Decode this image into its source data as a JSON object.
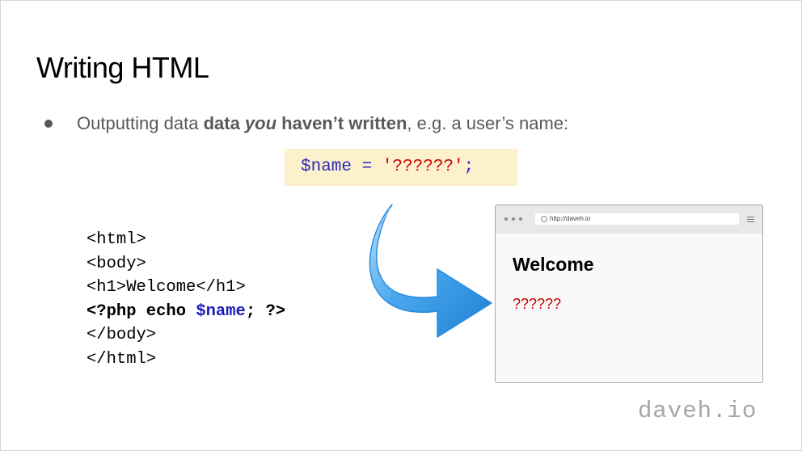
{
  "slide": {
    "title": "Writing HTML",
    "bullet": {
      "text_before": "Outputting data ",
      "bold_1": "data ",
      "bold_italic": "you",
      "bold_2": " haven’t written",
      "text_after": ", e.g. a user’s name:"
    },
    "php_assignment": {
      "variable": "$name",
      "operator": " = ",
      "string": "'??????'",
      "terminator": ";"
    },
    "code_lines": {
      "l1": "<html>",
      "l2": "<body>",
      "l3": "<h1>Welcome</h1>",
      "l4_start": "<?php echo ",
      "l4_var": "$name",
      "l4_end": "; ?>",
      "l5": "</body>",
      "l6": "</html>"
    },
    "browser": {
      "url": "http://daveh.io",
      "heading": "Welcome",
      "output": "??????"
    },
    "watermark": "daveh.io"
  },
  "colors": {
    "code_box_bg": "#fdf0cc",
    "variable": "#2b2bb8",
    "string": "#cc0000",
    "arrow": "#3aa0ec"
  },
  "icons": [
    "arrow-icon",
    "menu-icon",
    "url-icon"
  ]
}
